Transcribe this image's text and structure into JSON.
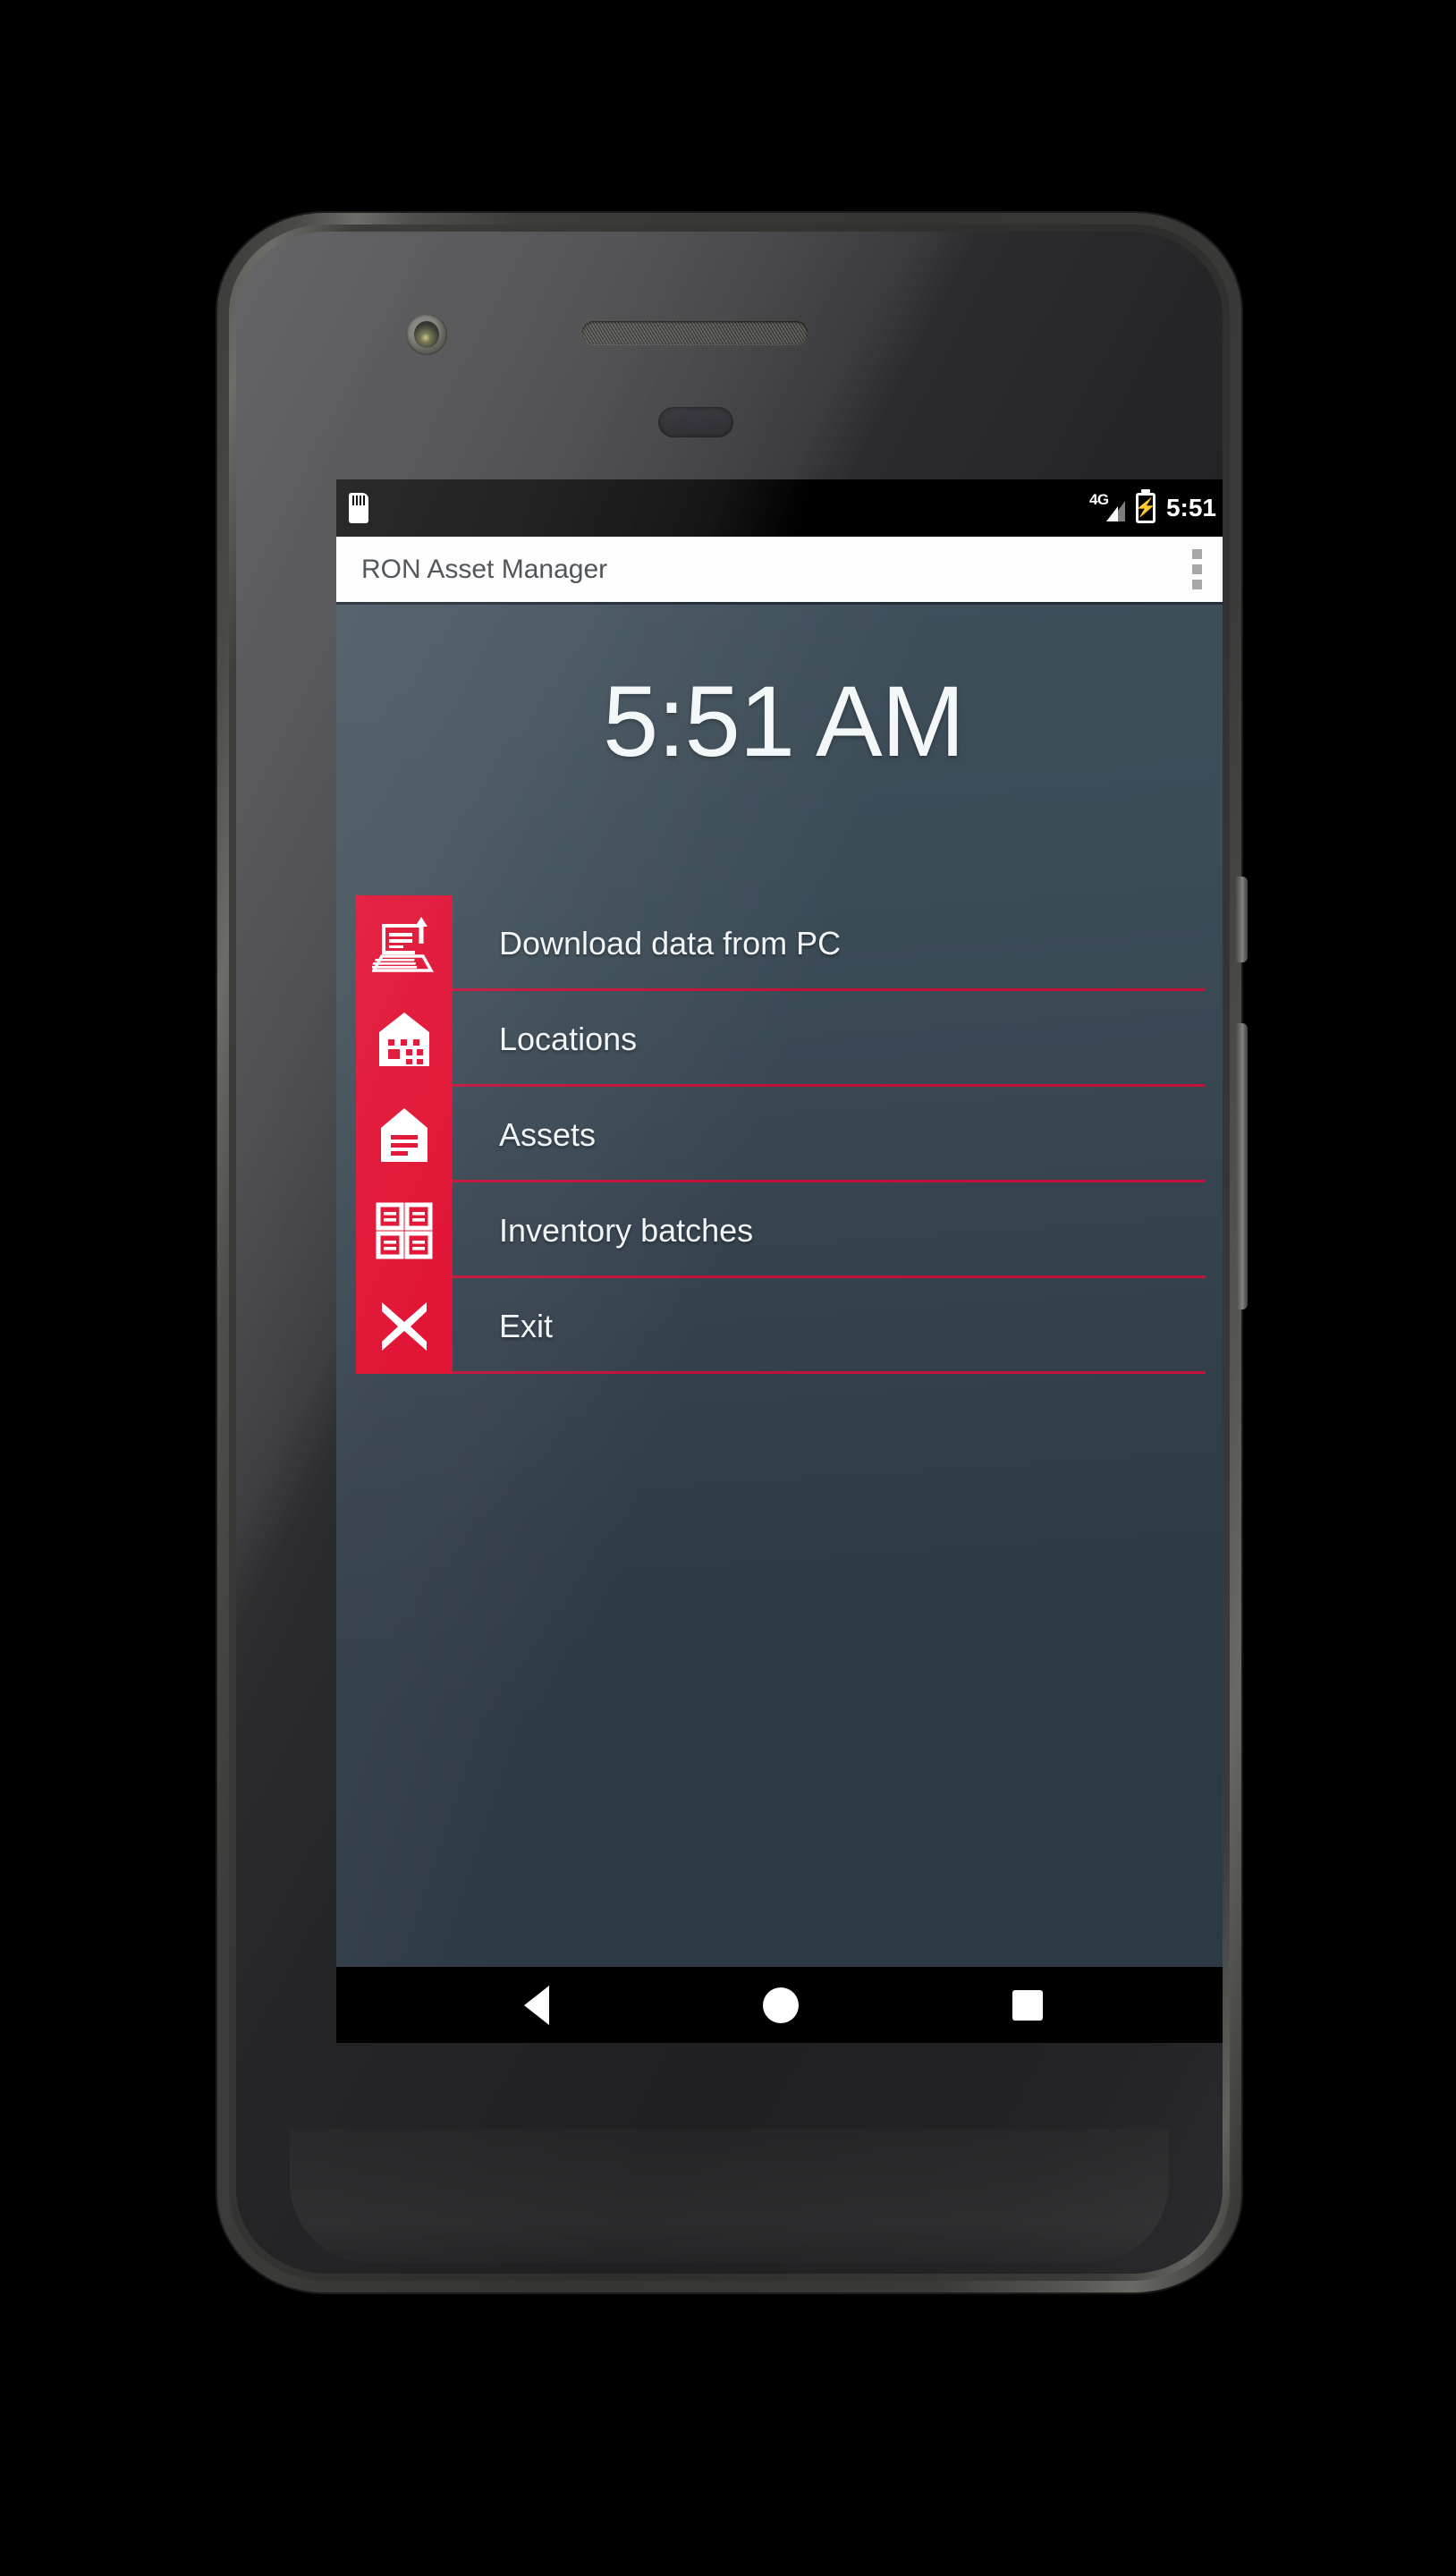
{
  "device": {
    "name": "android-phone",
    "sensors": {
      "front_camera": "front-camera",
      "earpiece": "earpiece-speaker",
      "proximity": "proximity-sensor"
    },
    "buttons": {
      "power": "power-button",
      "volume": "volume-rocker"
    }
  },
  "status_bar": {
    "sd_card_icon": "sd-card-icon",
    "network_label": "4G",
    "signal_icon": "signal-bars-icon",
    "battery_icon": "battery-charging-icon",
    "battery_bolt": "⚡",
    "clock": "5:51"
  },
  "app_bar": {
    "title": "RON Asset Manager",
    "overflow_icon": "overflow-menu-icon"
  },
  "main": {
    "clock_display": "5:51 AM",
    "menu_items": [
      {
        "label": "Download data from PC",
        "icon": "laptop-upload-icon",
        "name": "menu-item-download-data-from-pc"
      },
      {
        "label": "Locations",
        "icon": "building-icon",
        "name": "menu-item-locations"
      },
      {
        "label": "Assets",
        "icon": "asset-tag-icon",
        "name": "menu-item-assets"
      },
      {
        "label": "Inventory batches",
        "icon": "grid-documents-icon",
        "name": "menu-item-inventory-batches"
      },
      {
        "label": "Exit",
        "icon": "close-x-icon",
        "name": "menu-item-exit"
      }
    ]
  },
  "nav_bar": {
    "back": "back-icon",
    "home": "home-icon",
    "recents": "recents-icon"
  },
  "colors": {
    "accent_red": "#e00b2d",
    "divider_red": "#c4103a",
    "app_bg_top": "#3f4f5a",
    "app_bg_bottom": "#2d3945",
    "app_bar_bg": "#fdfdfd",
    "app_title_text": "#474d52"
  }
}
